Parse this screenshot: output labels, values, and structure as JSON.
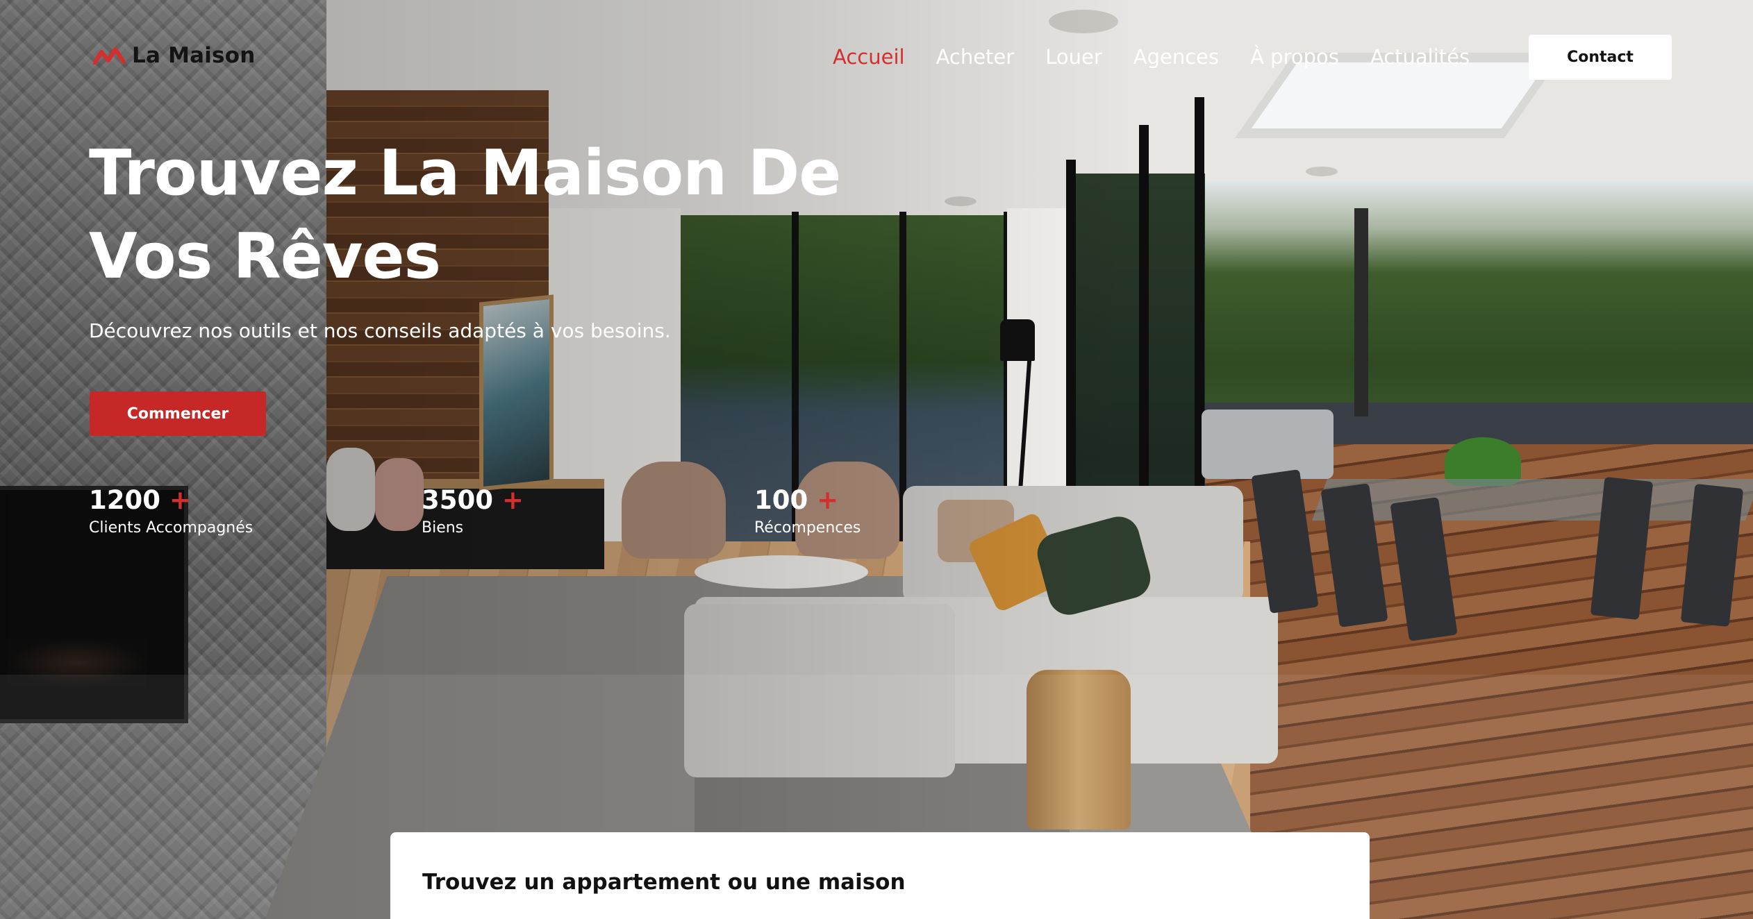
{
  "header": {
    "logo_text": "La Maison",
    "nav": [
      {
        "label": "Accueil",
        "active": true
      },
      {
        "label": "Acheter",
        "active": false
      },
      {
        "label": "Louer",
        "active": false
      },
      {
        "label": "Agences",
        "active": false
      },
      {
        "label": "À propos",
        "active": false
      },
      {
        "label": "Actualités",
        "active": false
      }
    ],
    "contact_label": "Contact"
  },
  "hero": {
    "title": "Trouvez La Maison De Vos Rêves",
    "subtitle": "Découvrez nos outils et nos conseils adaptés à vos besoins.",
    "cta_label": "Commencer",
    "stats": [
      {
        "value": "1200",
        "suffix": "+",
        "label": "Clients Accompagnés"
      },
      {
        "value": "3500",
        "suffix": "+",
        "label": "Biens"
      },
      {
        "value": "100",
        "suffix": "+",
        "label": "Récompences"
      }
    ]
  },
  "search": {
    "title": "Trouvez un appartement ou une maison"
  },
  "colors": {
    "accent": "#d32f2f",
    "button": "#c62828",
    "text_light": "#ffffff"
  }
}
